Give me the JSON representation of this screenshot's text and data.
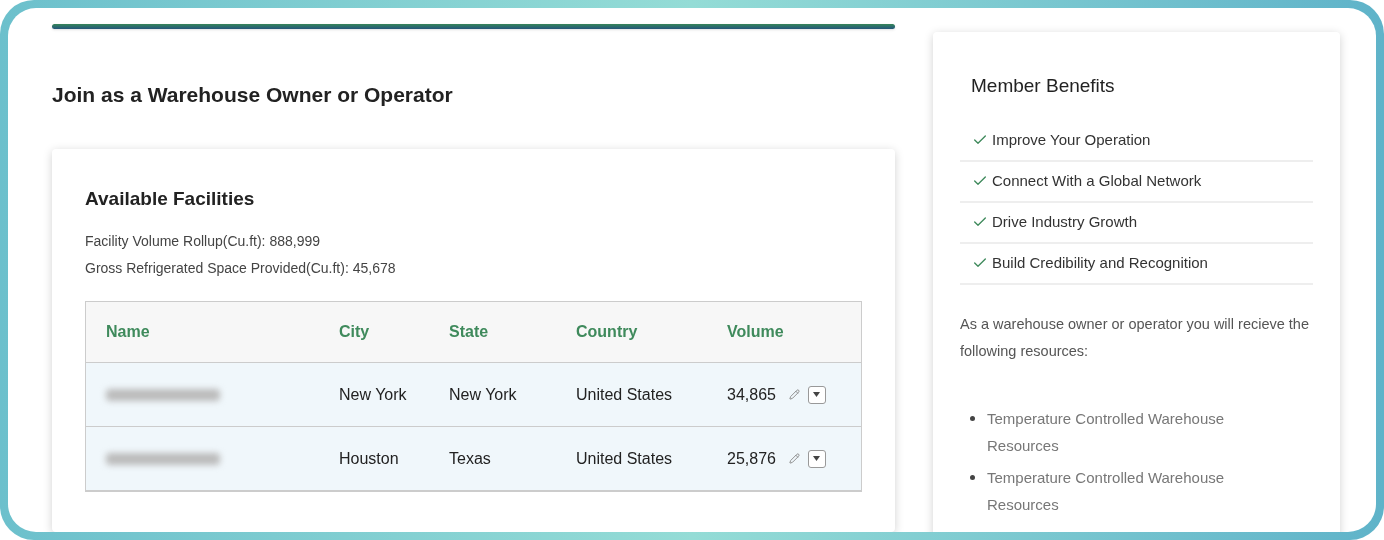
{
  "page_title": "Join as a Warehouse Owner or Operator",
  "facilities": {
    "title": "Available Facilities",
    "stats": [
      "Facility Volume Rollup(Cu.ft): 888,999",
      "Gross Refrigerated Space Provided(Cu.ft): 45,678"
    ],
    "columns": [
      "Name",
      "City",
      "State",
      "Country",
      "Volume"
    ],
    "rows": [
      {
        "city": "New York",
        "state": "New York",
        "country": "United States",
        "volume": "34,865"
      },
      {
        "city": "Houston",
        "state": "Texas",
        "country": "United States",
        "volume": "25,876"
      }
    ]
  },
  "benefits": {
    "title": "Member Benefits",
    "items": [
      "Improve Your Operation",
      "Connect With a Global Network",
      "Drive Industry Growth",
      "Build Credibility and Recognition"
    ],
    "intro": "As a warehouse owner or operator you will recieve the following resources:",
    "resources": [
      "Temperature Controlled Warehouse Resources",
      "Temperature Controlled Warehouse Resources"
    ]
  }
}
